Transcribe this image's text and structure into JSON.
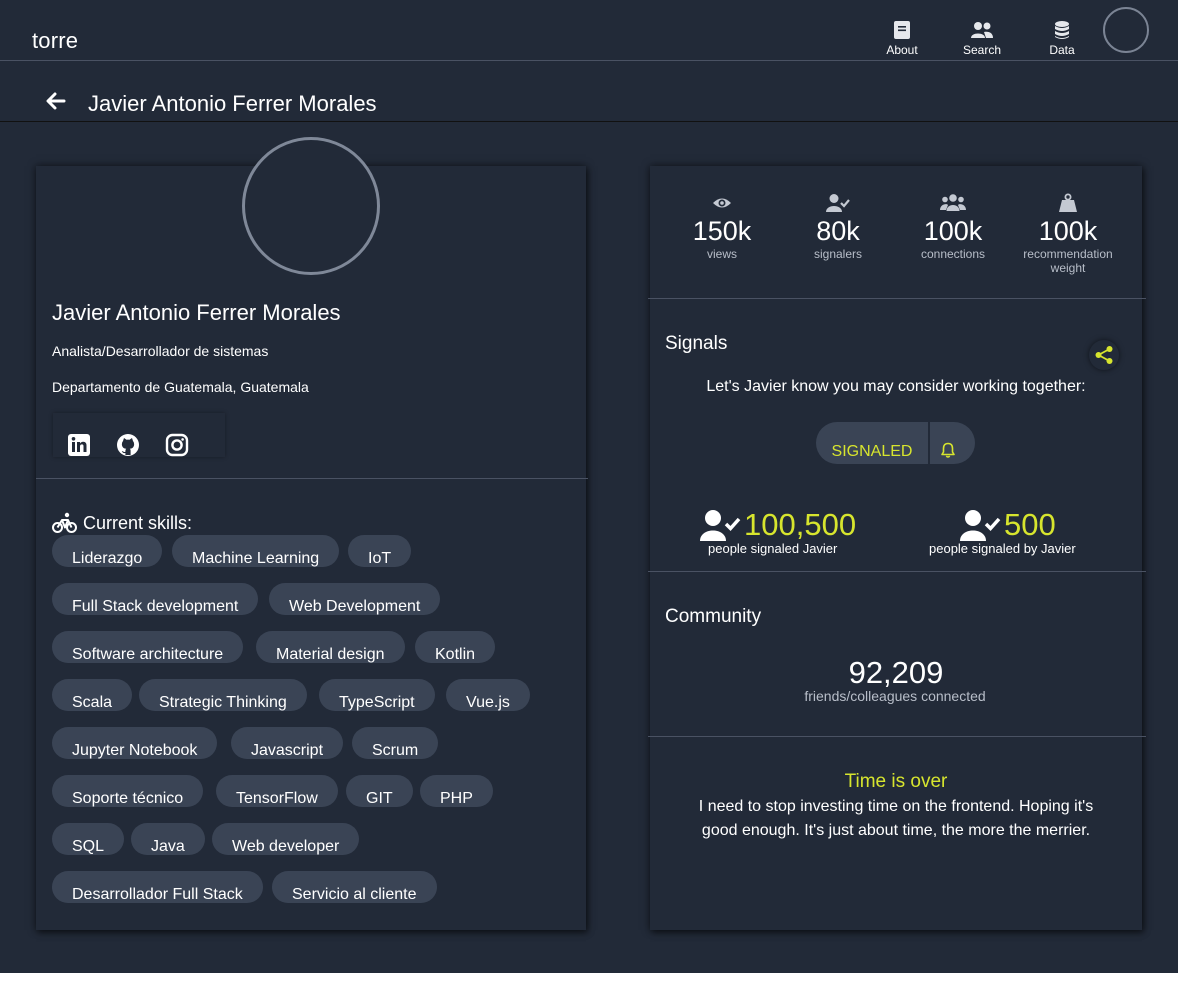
{
  "nav": {
    "brand": "torre",
    "items": [
      {
        "label": "About",
        "icon": "book-icon"
      },
      {
        "label": "Search",
        "icon": "users-icon"
      },
      {
        "label": "Data",
        "icon": "database-icon"
      }
    ]
  },
  "page": {
    "title": "Javier Antonio Ferrer Morales"
  },
  "profile": {
    "name": "Javier Antonio Ferrer Morales",
    "headline": "Analista/Desarrollador de sistemas",
    "location": "Departamento de Guatemala, Guatemala",
    "social": [
      "linkedin-icon",
      "github-icon",
      "instagram-icon"
    ]
  },
  "skills": {
    "title": "Current skills:",
    "items": [
      "Liderazgo",
      "Machine Learning",
      "IoT",
      "Full Stack development",
      "Web Development",
      "Software architecture",
      "Material design",
      "Kotlin",
      "Scala",
      "Strategic Thinking",
      "TypeScript",
      "Vue.js",
      "Jupyter Notebook",
      "Javascript",
      "Scrum",
      "Soporte técnico",
      "TensorFlow",
      "GIT",
      "PHP",
      "SQL",
      "Java",
      "Web developer",
      "Desarrollador Full Stack",
      "Servicio al cliente"
    ]
  },
  "stats": [
    {
      "value": "150k",
      "label": "views",
      "icon": "eye-icon"
    },
    {
      "value": "80k",
      "label": "signalers",
      "icon": "user-check-icon"
    },
    {
      "value": "100k",
      "label": "connections",
      "icon": "users-icon"
    },
    {
      "value": "100k",
      "label": "recommendation weight",
      "icon": "weight-icon"
    }
  ],
  "signals": {
    "title": "Signals",
    "prompt": "Let's Javier know you may consider working together:",
    "button_label": "SIGNALED",
    "received_count": "100,500",
    "received_label": "people signaled Javier",
    "given_count": "500",
    "given_label": "people signaled by Javier"
  },
  "community": {
    "title": "Community",
    "count": "92,209",
    "label": "friends/colleagues connected"
  },
  "notice": {
    "title": "Time is over",
    "text": "I need to stop investing time on the frontend. Hoping it's good enough. It's just about time, the more the merrier."
  },
  "colors": {
    "background": "#222a38",
    "accent": "#d7e52e",
    "chip": "#3a4455",
    "divider": "#4a5263"
  }
}
